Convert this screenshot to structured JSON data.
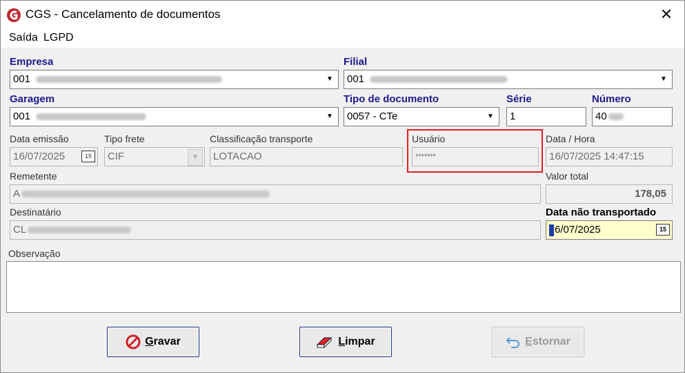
{
  "window": {
    "title": "CGS - Cancelamento de documentos"
  },
  "menu": [
    "Saída",
    "LGPD"
  ],
  "fields": {
    "empresa": {
      "label": "Empresa",
      "value": "001"
    },
    "filial": {
      "label": "Filial",
      "value": "001"
    },
    "garagem": {
      "label": "Garagem",
      "value": "001"
    },
    "tipo_documento": {
      "label": "Tipo de documento",
      "value": "0057 - CTe"
    },
    "serie": {
      "label": "Série",
      "value": "1"
    },
    "numero": {
      "label": "Número",
      "value": "40"
    },
    "data_emissao": {
      "label": "Data emissão",
      "value": "16/07/2025",
      "cal": "15"
    },
    "tipo_frete": {
      "label": "Tipo frete",
      "value": "CIF"
    },
    "classificacao": {
      "label": "Classificação transporte",
      "value": "LOTACAO"
    },
    "usuario": {
      "label": "Usuário",
      "value": "*******"
    },
    "data_hora": {
      "label": "Data / Hora",
      "value": "16/07/2025 14:47:15"
    },
    "remetente": {
      "label": "Remetente",
      "value": "A"
    },
    "valor_total": {
      "label": "Valor total",
      "value": "178,05"
    },
    "destinatario": {
      "label": "Destinatário",
      "value": "CL"
    },
    "data_nao_transportado": {
      "label": "Data não transportado",
      "value_first": "1",
      "value_rest": "6/07/2025",
      "cal": "15"
    },
    "observacao": {
      "label": "Observação"
    }
  },
  "buttons": {
    "gravar": {
      "first": "G",
      "rest": "ravar"
    },
    "limpar": {
      "first": "L",
      "rest": "impar"
    },
    "estornar": {
      "first": "E",
      "rest": "stornar"
    }
  },
  "colors": {
    "highlight": "#e02020",
    "label_blue": "#1a1a8c",
    "yellow_field": "#ffffcc"
  },
  "icons": [
    "cgs-logo-icon",
    "close-icon",
    "calendar-icon",
    "dropdown-arrow-icon",
    "no-entry-icon",
    "eraser-icon",
    "undo-arrow-icon"
  ]
}
